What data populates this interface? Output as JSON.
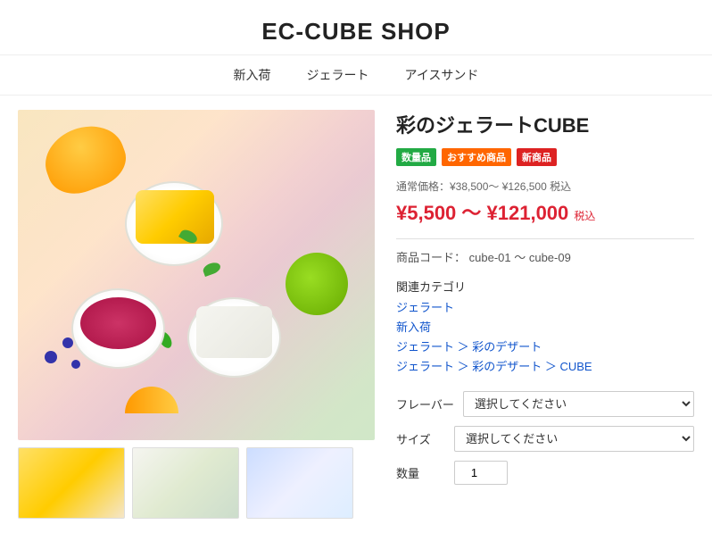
{
  "header": {
    "title": "EC-CUBE SHOP"
  },
  "nav": {
    "items": [
      {
        "label": "新入荷",
        "href": "#"
      },
      {
        "label": "ジェラート",
        "href": "#"
      },
      {
        "label": "アイスサンド",
        "href": "#"
      }
    ]
  },
  "product": {
    "title": "彩のジェラートCUBE",
    "badges": [
      {
        "label": "数量品",
        "type": "green"
      },
      {
        "label": "おすすめ商品",
        "type": "orange"
      },
      {
        "label": "新商品",
        "type": "red"
      }
    ],
    "price_regular_label": "通常価格：¥38,500～ ¥126,500 税込",
    "price_sale": "¥5,500 ～ ¥121,000",
    "price_tax_label": "税込",
    "product_code_label": "商品コード：",
    "product_code": "cube-01 ～ cube-09",
    "category_section_label": "関連カテゴリ",
    "category_links": [
      {
        "label": "ジェラート",
        "type": "link"
      },
      {
        "label": "新入荷",
        "type": "link"
      },
      {
        "label": "ジェラート ＞ 彩のデザート",
        "type": "link"
      },
      {
        "label": "ジェラート ＞ 彩のデザート ＞ CUBE",
        "type": "link"
      }
    ],
    "flavor_label": "フレーバー",
    "flavor_placeholder": "選択してください",
    "size_label": "サイズ",
    "size_placeholder": "選択してください",
    "qty_label": "数量",
    "qty_value": "1"
  },
  "thumbnails": [
    {
      "alt": "thumbnail 1"
    },
    {
      "alt": "thumbnail 2"
    },
    {
      "alt": "thumbnail 3"
    }
  ]
}
